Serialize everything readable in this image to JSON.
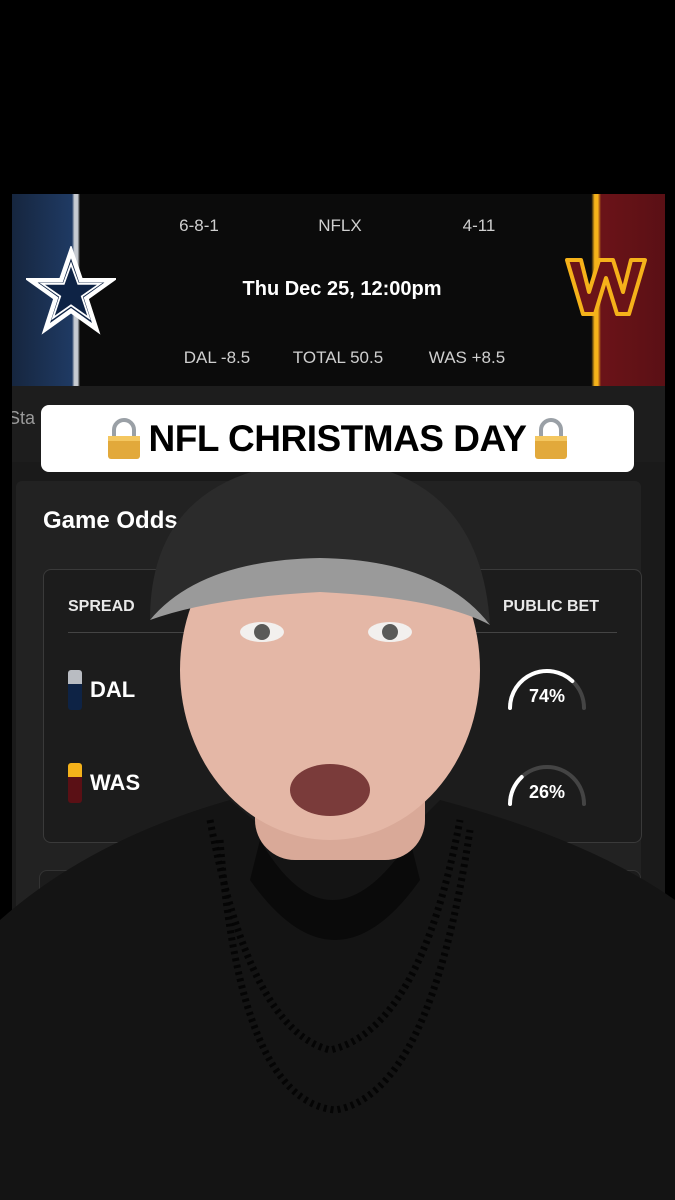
{
  "header": {
    "away_record": "6-8-1",
    "network": "NFLX",
    "home_record": "4-11",
    "game_time": "Thu Dec 25, 12:00pm",
    "away_spread": "DAL -8.5",
    "total": "TOTAL 50.5",
    "home_spread": "WAS +8.5"
  },
  "tabs": {
    "partial_label": "Sta"
  },
  "banner": {
    "text": "NFL CHRISTMAS DAY",
    "lock_icon": "lock-icon"
  },
  "odds": {
    "title": "Game Odds",
    "spread_header": "SPREAD",
    "public_header": "PUBLIC BET",
    "rows": [
      {
        "team": "DAL",
        "public_pct": "74%",
        "public_value": 0.74,
        "colors": [
          "#b9bcc2",
          "#0e2345"
        ]
      },
      {
        "team": "WAS",
        "public_pct": "26%",
        "public_value": 0.26,
        "colors": [
          "#f5b21a",
          "#5a1015"
        ]
      }
    ]
  },
  "colors": {
    "cowboys_navy": "#1f3a63",
    "commanders_burgundy": "#5a1015",
    "commanders_gold": "#f5b21a"
  }
}
